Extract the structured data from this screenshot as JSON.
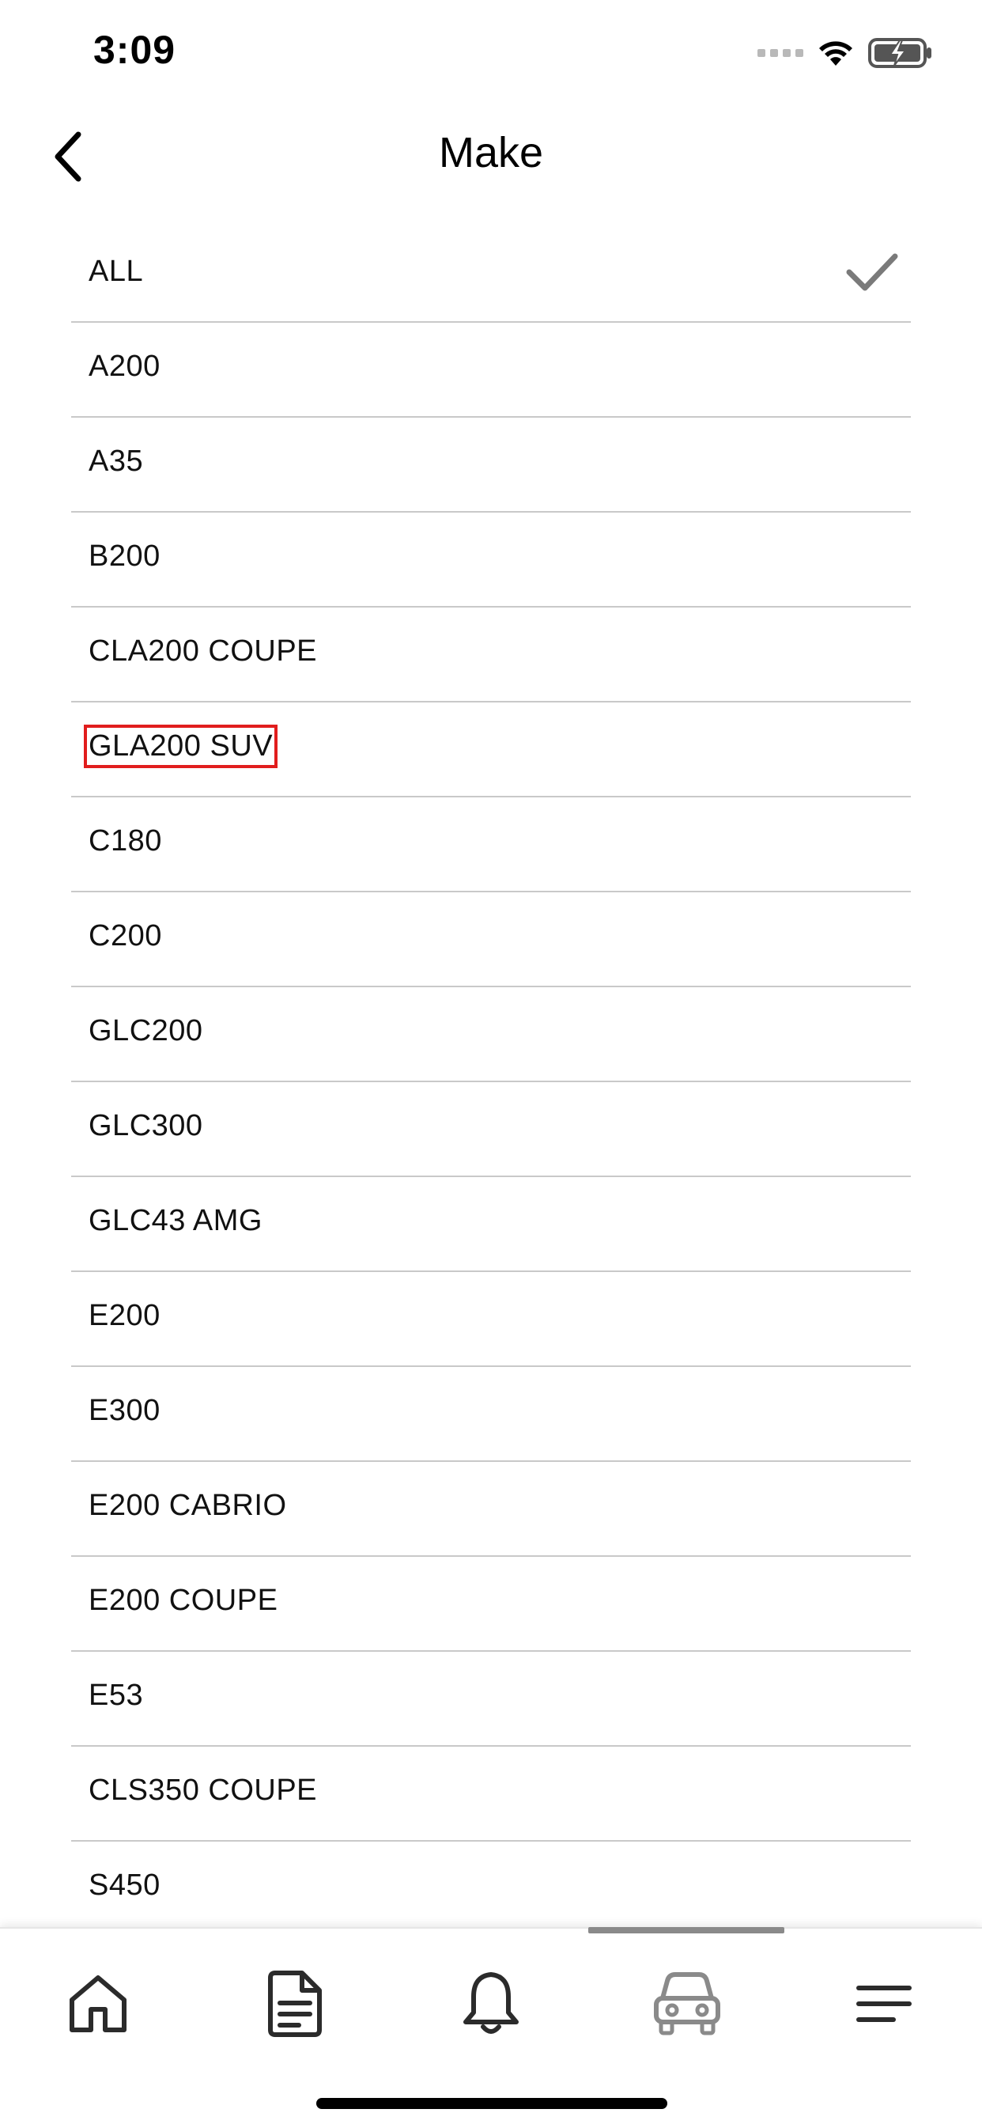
{
  "status_bar": {
    "time": "3:09",
    "icons": [
      "cellular-signal-icon",
      "wifi-icon",
      "battery-charging-icon"
    ]
  },
  "nav": {
    "title": "Make",
    "back_icon": "chevron-left-icon"
  },
  "make_list": {
    "selected": "ALL",
    "items": [
      {
        "label": "ALL"
      },
      {
        "label": "A200"
      },
      {
        "label": "A35"
      },
      {
        "label": "B200"
      },
      {
        "label": "CLA200 COUPE"
      },
      {
        "label": "GLA200 SUV"
      },
      {
        "label": "C180"
      },
      {
        "label": "C200"
      },
      {
        "label": "GLC200"
      },
      {
        "label": "GLC300"
      },
      {
        "label": "GLC43 AMG"
      },
      {
        "label": "E200"
      },
      {
        "label": "E300"
      },
      {
        "label": "E200 CABRIO"
      },
      {
        "label": "E200 COUPE"
      },
      {
        "label": "E53"
      },
      {
        "label": "CLS350 COUPE"
      },
      {
        "label": "S450"
      }
    ]
  },
  "tab_bar": {
    "active_tab": "vehicle",
    "tabs": [
      {
        "icon": "home-icon"
      },
      {
        "icon": "document-icon"
      },
      {
        "icon": "bell-icon"
      },
      {
        "icon": "car-icon"
      },
      {
        "icon": "menu-icon"
      }
    ]
  },
  "colors": {
    "highlight_outline": "#e11d1d",
    "divider": "#c9c9c9",
    "check": "#7a7a7a",
    "active_tab_icon": "#8a8a8a",
    "inactive_tab_icon": "#2b2b2b"
  }
}
